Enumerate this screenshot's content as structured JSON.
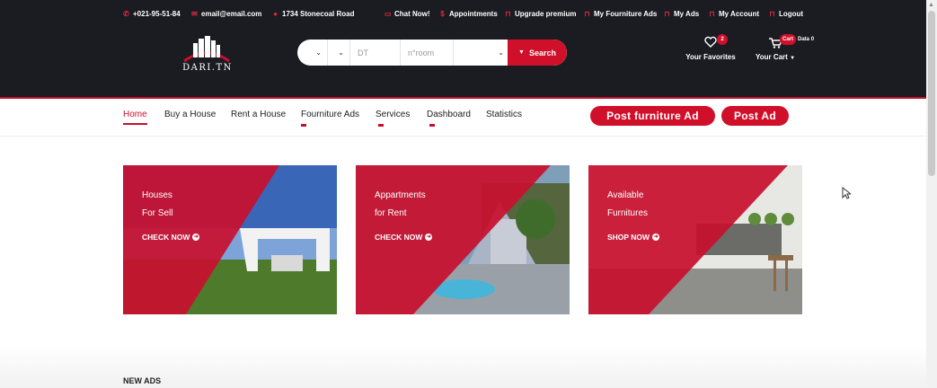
{
  "topbar": {
    "phone": "+021-95-51-84",
    "email": "email@email.com",
    "address": "1734 Stonecoal Road",
    "links": [
      "Chat Now!",
      "Appointments",
      "Upgrade premium",
      "My Fourniture Ads",
      "My Ads",
      "My Account",
      "Logout"
    ]
  },
  "brand": {
    "logo_text": "DARI.TN"
  },
  "search": {
    "field1_value": "",
    "field2_value": "",
    "field3_placeholder": "DT",
    "field4_placeholder": "n°room",
    "field5_value": "",
    "button_label": "Search"
  },
  "favorites": {
    "label": "Your Favorites",
    "count": "2"
  },
  "cart": {
    "label": "Your Cart",
    "badge_left": "Cart",
    "badge_right": "Data 0"
  },
  "nav": {
    "items": [
      "Home",
      "Buy a House",
      "Rent a House",
      "Fourniture Ads",
      "Services",
      "Dashboard",
      "Statistics"
    ],
    "active": "Home",
    "post_furniture": "Post furniture Ad",
    "post_ad": "Post Ad"
  },
  "cards": [
    {
      "line1": "Houses",
      "line2": "For Sell",
      "cta": "CHECK NOW"
    },
    {
      "line1": "Appartments",
      "line2": "for Rent",
      "cta": "CHECK NOW"
    },
    {
      "line1": "Available",
      "line2": "Furnitures",
      "cta": "SHOP NOW"
    }
  ],
  "section": {
    "new_ads": "NEW ADS"
  },
  "colors": {
    "accent": "#c8102e",
    "header_bg": "#1b1c22"
  }
}
